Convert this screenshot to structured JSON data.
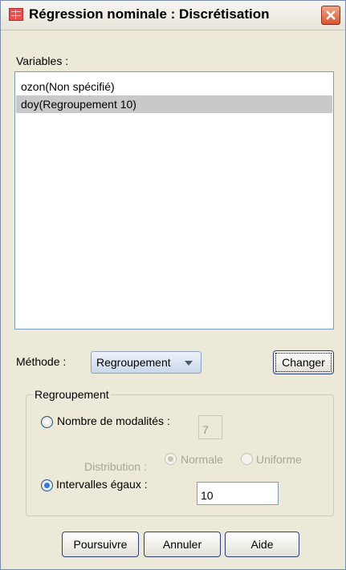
{
  "window": {
    "title": "Régression nominale : Discrétisation"
  },
  "variables": {
    "label": "Variables :",
    "items": [
      {
        "label": "ozon(Non spécifié)",
        "selected": false
      },
      {
        "label": "doy(Regroupement 10)",
        "selected": true
      }
    ]
  },
  "method": {
    "label": "Méthode :",
    "selected": "Regroupement",
    "change_button": "Changer"
  },
  "grouping": {
    "legend": "Regroupement",
    "num_categories": {
      "label": "Nombre de modalités :",
      "value": "7",
      "checked": false
    },
    "distribution": {
      "label": "Distribution :",
      "normal": "Normale",
      "uniform": "Uniforme",
      "selected": "Normale",
      "enabled": false
    },
    "equal_intervals": {
      "label": "Intervalles égaux :",
      "value": "10",
      "checked": true
    }
  },
  "buttons": {
    "continue": "Poursuivre",
    "cancel": "Annuler",
    "help": "Aide"
  },
  "colors": {
    "selection": "#c9c9c9",
    "close": "#d9552f",
    "radio_dot": "#2c7be0"
  }
}
